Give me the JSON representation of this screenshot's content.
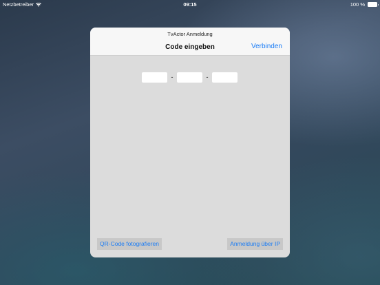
{
  "status_bar": {
    "carrier": "Netzbetreiber",
    "time": "09:15",
    "battery": "100 %"
  },
  "dialog": {
    "prompt": "TvActor Anmeldung",
    "title": "Code eingeben",
    "connect_label": "Verbinden",
    "code_fields": [
      "",
      "",
      ""
    ],
    "separator": "-",
    "qr_button": "QR-Code fotografieren",
    "ip_button": "Anmeldung über IP"
  },
  "colors": {
    "accent": "#1a7cf5",
    "dialog_body": "#dcdcdc",
    "nav_bar": "#f7f7f7"
  }
}
